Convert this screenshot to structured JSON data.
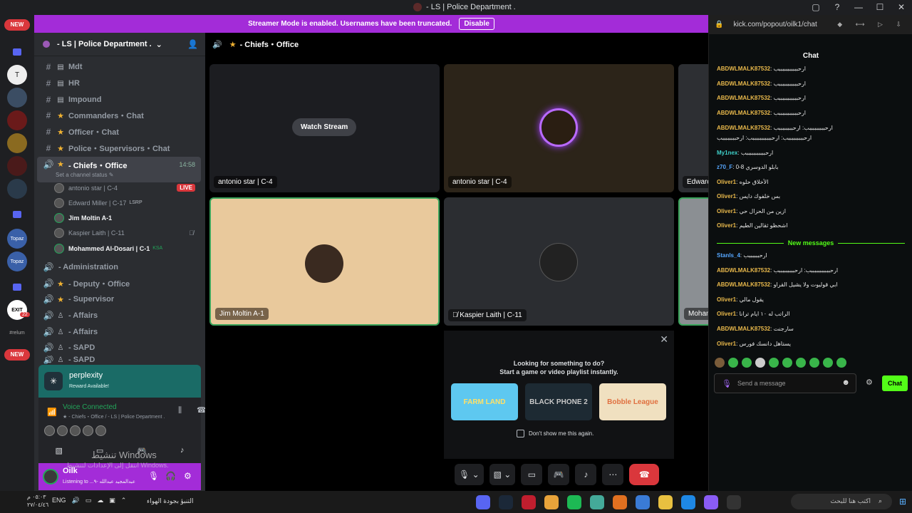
{
  "window": {
    "title": "- LS | Police Department .",
    "controls": [
      "▢",
      "?",
      "—",
      "☐",
      "✕"
    ]
  },
  "rail": {
    "new_label_top": "NEW",
    "new_label_bottom": "NEW",
    "badge": "22",
    "server_labels": [
      "Topaz",
      "Topaz",
      "EXIT",
      "#relum"
    ]
  },
  "banner": {
    "text": "Streamer Mode is enabled. Usernames have been truncated.",
    "button": "Disable"
  },
  "sidebar": {
    "server_name": "- LS | Police Department .",
    "channels": [
      {
        "name": "Mdt",
        "icon": "#"
      },
      {
        "name": "HR",
        "icon": "#"
      },
      {
        "name": "Impound",
        "icon": "#"
      },
      {
        "name": "Commanders・Chat",
        "icon": "#",
        "star": true
      },
      {
        "name": "Officer・Chat",
        "icon": "#",
        "star": true
      },
      {
        "name": "Police・Supervisors・Chat",
        "icon": "#",
        "star": true
      }
    ],
    "active_channel": {
      "name": "- Chiefs・Office",
      "time": "14:58",
      "status": "Set a channel status ✎"
    },
    "voice_users": [
      {
        "name": "antonio star | C-4",
        "live": "LIVE"
      },
      {
        "name": "Edward Miller | C-17",
        "tag": "LSRP"
      },
      {
        "name": "Jim Moltin A-1"
      },
      {
        "name": "Kaspier Laith | C-11",
        "muted": true
      },
      {
        "name": "Mohammed Al-Dosari | C-1",
        "tag": "KSA"
      }
    ],
    "channels_after": [
      {
        "name": "- Administration"
      },
      {
        "name": "- Deputy・Office",
        "star": true
      },
      {
        "name": "- Supervisor",
        "star": true
      },
      {
        "name": "- Affairs"
      },
      {
        "name": "- Affairs"
      },
      {
        "name": "- SAPD"
      },
      {
        "name": "- SAPD"
      }
    ]
  },
  "perplexity": {
    "name": "perplexity",
    "sub": "Reward Available!"
  },
  "voice_panel": {
    "status": "Voice Connected",
    "location": "★ - Chiefs・Office / - LS | Police Department ."
  },
  "user_panel": {
    "name": "Oilk",
    "status": "Listening to ...عبدالمجيد عبدالله  -٩"
  },
  "watermark": {
    "line1": "تنشيط Windows",
    "line2": "انتقل إلى الإعدادات لتنشيط Windows."
  },
  "main": {
    "header": "- Chiefs・Office",
    "tiles": [
      {
        "label": "antonio star | C-4",
        "watch": "Watch Stream"
      },
      {
        "label": "antonio star | C-4"
      },
      {
        "label": "Edward"
      },
      {
        "label": "Jim Moltin A-1"
      },
      {
        "label": "Kaspier Laith | C-11"
      },
      {
        "label": "Moham"
      }
    ],
    "activity": {
      "line1": "Looking for something to do?",
      "line2": "Start a game or video playlist instantly.",
      "games": [
        "FARM LAND",
        "BLACK PHONE 2",
        "Bobble League"
      ],
      "dont_show": "Don't show me this again."
    }
  },
  "kick": {
    "url": "kick.com/popout/oilk1/chat",
    "title": "Chat",
    "messages": [
      {
        "user": "ABDWLMALK87532",
        "color": "gold",
        "text": ": ارحبببببببببببب"
      },
      {
        "user": "ABDWLMALK87532",
        "color": "gold",
        "text": ": ارحبببببببببببب"
      },
      {
        "user": "ABDWLMALK87532",
        "color": "gold",
        "text": ": ارحبببببببببببب"
      },
      {
        "user": "ABDWLMALK87532",
        "color": "gold",
        "text": ": ارحبببببببببببب"
      },
      {
        "user": "ABDWLMALK87532",
        "color": "gold",
        "text": ": ارحبببببببببب: ارحببببببببب"
      },
      {
        "user": "",
        "color": "gold",
        "text": "ارحبببببببببب: ارحبببببببببببب: ارحببببببببب"
      },
      {
        "user": "My1nex",
        "color": "teal",
        "text": ": ارحبببببببببببب"
      },
      {
        "user": "z70_F",
        "color": "blue",
        "text": ": 0-8 بابلو الدوسري"
      },
      {
        "user": "Oliver1",
        "color": "gold",
        "text": ": الأخلاق حلوه"
      },
      {
        "user": "Oliver1",
        "color": "gold",
        "text": ": بس خلفوك دايس"
      },
      {
        "user": "Oliver1",
        "color": "gold",
        "text": ": ازين من الحزال حي"
      },
      {
        "user": "Oliver1",
        "color": "gold",
        "text": ": اشحظو ثقالين الطيم"
      }
    ],
    "new_messages": "New messages",
    "messages_after": [
      {
        "user": "Stanls_4",
        "color": "blue",
        "text": ": ارحببببببب"
      },
      {
        "user": "ABDWLMALK87532",
        "color": "gold",
        "text": ": ارحبببببببببببب: ارحبببببببببب"
      },
      {
        "user": "ABDWLMALK87532",
        "color": "gold",
        "text": ": ابي قوليوت ولا يشيل القراو"
      },
      {
        "user": "Oliver1",
        "color": "gold",
        "text": ": يقول مالي"
      },
      {
        "user": "Oliver1",
        "color": "gold",
        "text": ": الراتب له ١٠ ايام ترانا"
      },
      {
        "user": "ABDWLMALK87532",
        "color": "gold",
        "text": ": سارجنت"
      },
      {
        "user": "Oliver1",
        "color": "gold",
        "text": ": يستاهل دانسك فورس"
      }
    ],
    "placeholder": "Send a message",
    "chat_button": "Chat"
  },
  "taskbar": {
    "lang": "ENG",
    "clock_time": "٠٥:٠٣ م",
    "clock_date": "٢٧/٠٤/٤٦",
    "weather": "التنبؤ بجودة الهواء",
    "search": "اكتب هنا للبحث"
  }
}
